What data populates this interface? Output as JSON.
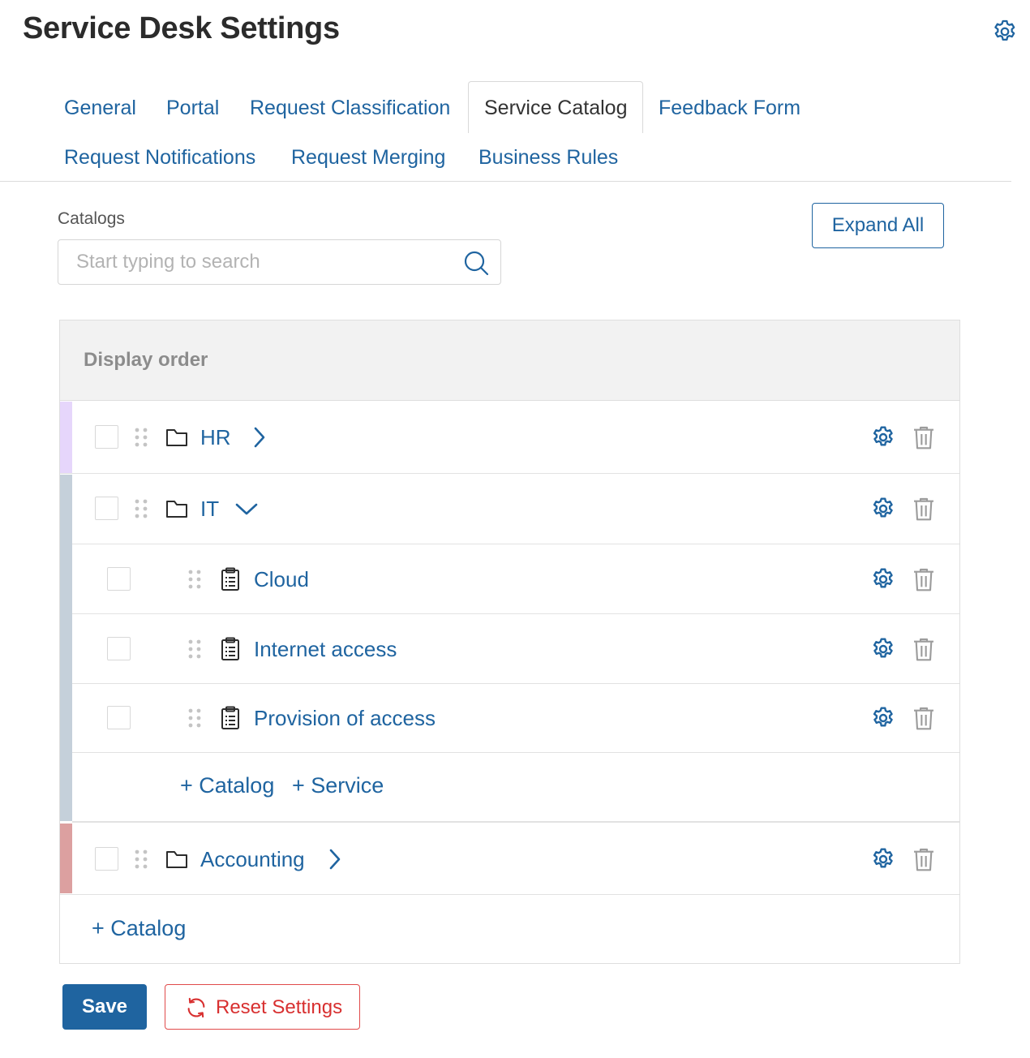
{
  "header": {
    "title": "Service Desk Settings",
    "settings_icon": "gear-icon"
  },
  "tabs": [
    {
      "label": "General",
      "active": false
    },
    {
      "label": "Portal",
      "active": false
    },
    {
      "label": "Request Classification",
      "active": false
    },
    {
      "label": "Service Catalog",
      "active": true
    },
    {
      "label": "Feedback Form",
      "active": false
    },
    {
      "label": "Request Notifications",
      "active": false
    },
    {
      "label": "Request Merging",
      "active": false
    },
    {
      "label": "Business Rules",
      "active": false
    }
  ],
  "catalogs": {
    "label": "Catalogs",
    "search_placeholder": "Start typing to search",
    "search_value": "",
    "expand_all_label": "Expand All"
  },
  "table": {
    "header": "Display order",
    "rows": [
      {
        "type": "catalog",
        "label": "HR",
        "icon": "folder-icon",
        "expanded": false,
        "stripe_color": "#e6d6fb"
      },
      {
        "type": "catalog",
        "label": "IT",
        "icon": "folder-icon",
        "expanded": true,
        "stripe_color": "#c5d0da"
      },
      {
        "type": "service",
        "label": "Cloud",
        "icon": "clipboard-list-icon"
      },
      {
        "type": "service",
        "label": "Internet access",
        "icon": "clipboard-list-icon"
      },
      {
        "type": "service",
        "label": "Provision of access",
        "icon": "clipboard-list-icon"
      },
      {
        "type": "catalog",
        "label": "Accounting",
        "icon": "folder-icon",
        "expanded": false,
        "stripe_color": "#dca0a0"
      }
    ],
    "it_add_catalog": "+ Catalog",
    "it_add_service": "+ Service",
    "add_catalog": "+ Catalog"
  },
  "footer": {
    "save_label": "Save",
    "reset_label": "Reset Settings"
  },
  "colors": {
    "accent": "#1f64a0",
    "danger": "#d83030",
    "header_bg": "#f2f2f2"
  }
}
